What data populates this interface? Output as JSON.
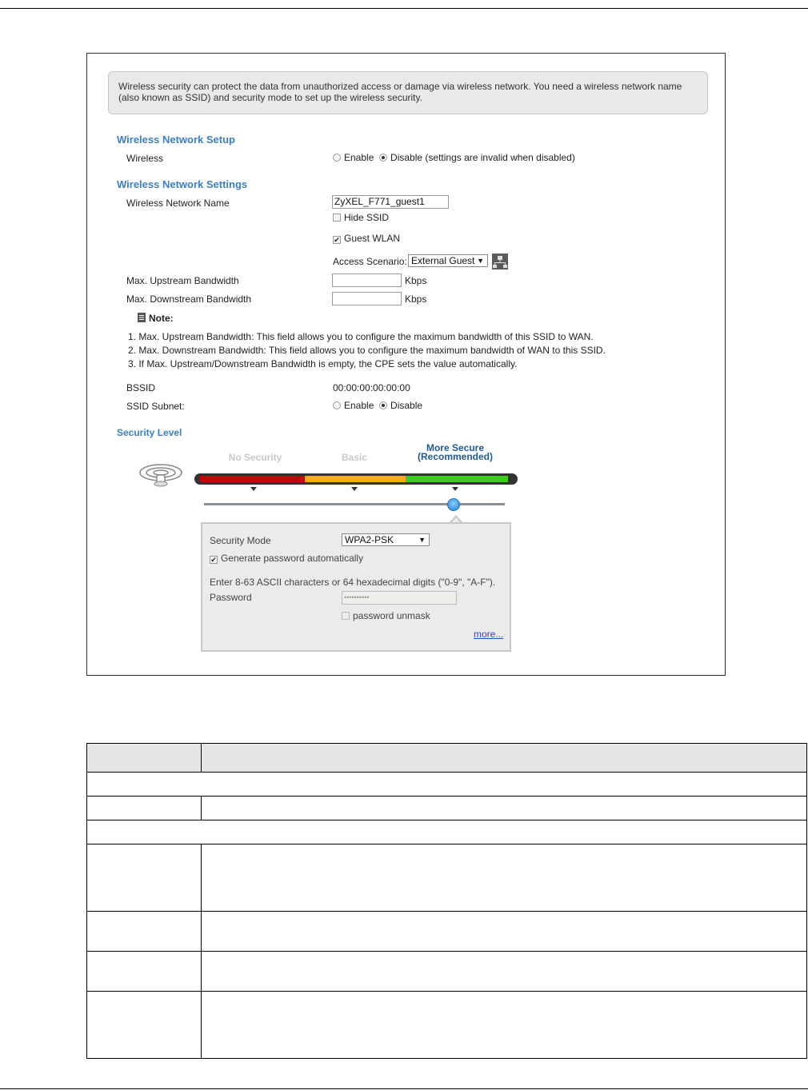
{
  "info": {
    "text": "Wireless security can protect the data from unauthorized access or damage via wireless network. You need a wireless network name (also known as SSID) and security mode to set up the wireless security."
  },
  "wireless_setup": {
    "title": "Wireless Network Setup",
    "wireless_label": "Wireless",
    "enable_label": "Enable",
    "disable_label": "Disable (settings are invalid when disabled)",
    "selected": "disable"
  },
  "network_settings": {
    "title": "Wireless Network Settings",
    "name_label": "Wireless Network Name",
    "name_value": "ZyXEL_F771_guest1",
    "hide_ssid_label": "Hide SSID",
    "hide_ssid_checked": false,
    "guest_wlan_label": "Guest WLAN",
    "guest_wlan_checked": true,
    "access_scenario_label": "Access Scenario:",
    "access_scenario_value": "External Guest",
    "upstream_label": "Max. Upstream Bandwidth",
    "upstream_value": "",
    "downstream_label": "Max. Downstream Bandwidth",
    "downstream_value": "",
    "kbps_unit": "Kbps"
  },
  "note": {
    "label": "Note:",
    "lines": [
      "1. Max. Upstream Bandwidth: This field allows you to configure the maximum bandwidth of this SSID to WAN.",
      "2. Max. Downstream Bandwidth: This field allows you to configure the maximum bandwidth of WAN to this SSID.",
      "3. If Max. Upstream/Downstream Bandwidth is empty, the CPE sets the value automatically."
    ]
  },
  "bssid": {
    "label": "BSSID",
    "value": "00:00:00:00:00:00"
  },
  "ssid_subnet": {
    "label": "SSID Subnet:",
    "enable_label": "Enable",
    "disable_label": "Disable",
    "selected": "disable"
  },
  "security_level": {
    "title": "Security Level",
    "levels": [
      {
        "label": "No Security",
        "color": "#c8000a"
      },
      {
        "label": "Basic",
        "color": "#f4b000"
      },
      {
        "label": "More Secure",
        "label2": "(Recommended)",
        "color": "#3ecc1c"
      }
    ],
    "selected_index": 2,
    "active_label_color": "#1f5b96"
  },
  "security_panel": {
    "mode_label": "Security Mode",
    "mode_value": "WPA2-PSK",
    "generate_label": "Generate password automatically",
    "generate_checked": true,
    "hint": "Enter 8-63 ASCII characters or 64 hexadecimal digits (\"0-9\", \"A-F\").",
    "password_label": "Password",
    "password_value": "••••••••••",
    "unmask_label": "password unmask",
    "unmask_checked": false,
    "more_link": "more..."
  },
  "colors": {
    "section_title": "#3b7fc4",
    "link": "#1a55c4",
    "table_header_bg": "#e6e6e6"
  }
}
